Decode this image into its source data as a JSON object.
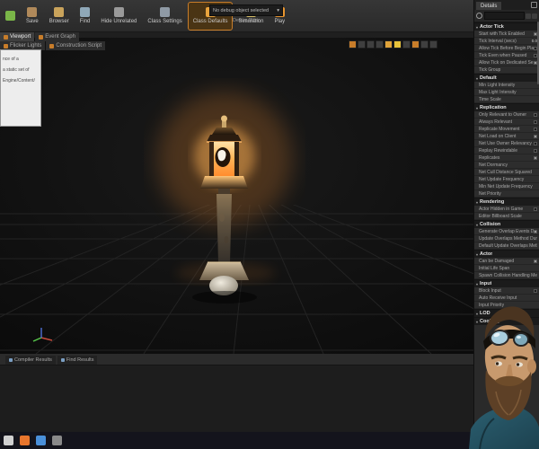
{
  "toolbar": {
    "items": [
      {
        "id": "compile",
        "label": "",
        "icon": "compile-icon",
        "icon_color": "#7ab648",
        "active": false
      },
      {
        "id": "save",
        "label": "Save",
        "icon": "save-icon",
        "icon_color": "#b0895a",
        "active": false
      },
      {
        "id": "browser",
        "label": "Browser",
        "icon": "browser-icon",
        "icon_color": "#c9a35b",
        "active": false
      },
      {
        "id": "find",
        "label": "Find",
        "icon": "find-icon",
        "icon_color": "#8fa8b8",
        "active": false
      },
      {
        "id": "hide-unrelated",
        "label": "Hide Unrelated",
        "icon": "hide-unrelated-icon",
        "icon_color": "#9a9a9a",
        "active": false
      },
      {
        "id": "class-settings",
        "label": "Class Settings",
        "icon": "class-settings-icon",
        "icon_color": "#8f9aa5",
        "active": false
      },
      {
        "id": "class-defaults",
        "label": "Class Defaults",
        "icon": "class-defaults-icon",
        "icon_color": "#e8a33d",
        "active": true
      },
      {
        "id": "simulation",
        "label": "Simulation",
        "icon": "simulation-icon",
        "icon_color": "#d8c06a",
        "active": false
      },
      {
        "id": "play",
        "label": "Play",
        "icon": "play-icon",
        "icon_color": "#e8952f",
        "active": false
      }
    ],
    "debug": {
      "selected": "No debug object selected",
      "filter_label": "Debug Filter"
    }
  },
  "icons": {
    "chevron_down": "▾"
  },
  "tabs": {
    "rows": [
      [
        {
          "label": "Viewport",
          "icon": "viewport-icon",
          "active": true
        },
        {
          "label": "Event Graph",
          "icon": "graph-icon",
          "active": false
        }
      ],
      [
        {
          "label": "Flicker Lights",
          "icon": "graph-icon",
          "active": false
        },
        {
          "label": "Construction Script",
          "icon": "graph-icon",
          "active": false
        }
      ]
    ]
  },
  "popup": {
    "lines": [
      "nce of a",
      "a static set of",
      "Engine/Content/"
    ]
  },
  "viewport": {
    "toolbar_buttons": [
      {
        "name": "camera-speed",
        "color": "#c87d2a"
      },
      {
        "name": "view-mode",
        "color": "#3f3f3f"
      },
      {
        "name": "lit-mode",
        "color": "#3f3f3f"
      },
      {
        "name": "show-flags",
        "color": "#3f3f3f"
      },
      {
        "name": "grid-snap",
        "color": "#e0a33a"
      },
      {
        "name": "rotation-snap",
        "color": "#e8c23a"
      },
      {
        "name": "scale-snap",
        "color": "#3f3f3f"
      },
      {
        "name": "surface-snap",
        "color": "#c87d2a"
      },
      {
        "name": "camera-settings",
        "color": "#3f3f3f"
      },
      {
        "name": "maximize",
        "color": "#3f3f3f"
      }
    ]
  },
  "results_tabs": [
    {
      "label": "Compiler Results"
    },
    {
      "label": "Find Results"
    }
  ],
  "details": {
    "title": "Details",
    "sections": [
      {
        "name": "Actor Tick",
        "rows": [
          {
            "label": "Start with Tick Enabled",
            "control": "checkbox",
            "checked": true
          },
          {
            "label": "Tick Interval (secs)",
            "control": "value",
            "value": "0.0"
          },
          {
            "label": "Allow Tick Before Begin Play",
            "control": "checkbox",
            "checked": false
          },
          {
            "label": "Tick Even when Paused",
            "control": "checkbox",
            "checked": false
          },
          {
            "label": "Allow Tick on Dedicated Server",
            "control": "checkbox",
            "checked": true
          },
          {
            "label": "Tick Group",
            "control": "value",
            "value": ""
          }
        ]
      },
      {
        "name": "Default",
        "rows": [
          {
            "label": "Min Light Intensity",
            "control": "value",
            "value": ""
          },
          {
            "label": "Max Light Intensity",
            "control": "value",
            "value": ""
          },
          {
            "label": "Time Scale",
            "control": "value",
            "value": ""
          }
        ]
      },
      {
        "name": "Replication",
        "rows": [
          {
            "label": "Only Relevant to Owner",
            "control": "checkbox",
            "checked": false
          },
          {
            "label": "Always Relevant",
            "control": "checkbox",
            "checked": false
          },
          {
            "label": "Replicate Movement",
            "control": "checkbox",
            "checked": false
          },
          {
            "label": "Net Load on Client",
            "control": "checkbox",
            "checked": true
          },
          {
            "label": "Net Use Owner Relevancy",
            "control": "checkbox",
            "checked": false
          },
          {
            "label": "Replay Rewindable",
            "control": "checkbox",
            "checked": false
          },
          {
            "label": "Replicates",
            "control": "checkbox",
            "checked": true
          },
          {
            "label": "Net Dormancy",
            "control": "value",
            "value": ""
          },
          {
            "label": "Net Cull Distance Squared",
            "control": "value",
            "value": ""
          },
          {
            "label": "Net Update Frequency",
            "control": "value",
            "value": ""
          },
          {
            "label": "Min Net Update Frequency",
            "control": "value",
            "value": ""
          },
          {
            "label": "Net Priority",
            "control": "value",
            "value": ""
          }
        ]
      },
      {
        "name": "Rendering",
        "rows": [
          {
            "label": "Actor Hidden in Game",
            "control": "checkbox",
            "checked": false
          },
          {
            "label": "Editor Billboard Scale",
            "control": "value",
            "value": ""
          }
        ]
      },
      {
        "name": "Collision",
        "rows": [
          {
            "label": "Generate Overlap Events During Level Str",
            "control": "checkbox",
            "checked": true
          },
          {
            "label": "Update Overlaps Method During Level Str",
            "control": "value",
            "value": ""
          },
          {
            "label": "Default Update Overlaps Method During",
            "control": "value",
            "value": ""
          }
        ]
      },
      {
        "name": "Actor",
        "rows": [
          {
            "label": "Can be Damaged",
            "control": "checkbox",
            "checked": true
          },
          {
            "label": "Initial Life Span",
            "control": "value",
            "value": ""
          },
          {
            "label": "Spawn Collision Handling Method",
            "control": "value",
            "value": ""
          }
        ]
      },
      {
        "name": "Input",
        "rows": [
          {
            "label": "Block Input",
            "control": "checkbox",
            "checked": false
          },
          {
            "label": "Auto Receive Input",
            "control": "value",
            "value": ""
          },
          {
            "label": "Input Priority",
            "control": "value",
            "value": ""
          }
        ]
      },
      {
        "name": "LOD",
        "rows": []
      },
      {
        "name": "Cooking",
        "rows": []
      }
    ]
  },
  "taskbar": {
    "icons": [
      {
        "name": "start-icon",
        "color": "#d0d0d0"
      },
      {
        "name": "firefox-icon",
        "color": "#e8762d"
      },
      {
        "name": "chrome-icon",
        "color": "#4a90d9"
      },
      {
        "name": "app-icon",
        "color": "#8a8a8a"
      }
    ]
  },
  "colors": {
    "accent": "#e8952f",
    "glow": "#ff9a3d",
    "panel_bg": "#2a2a2a"
  }
}
